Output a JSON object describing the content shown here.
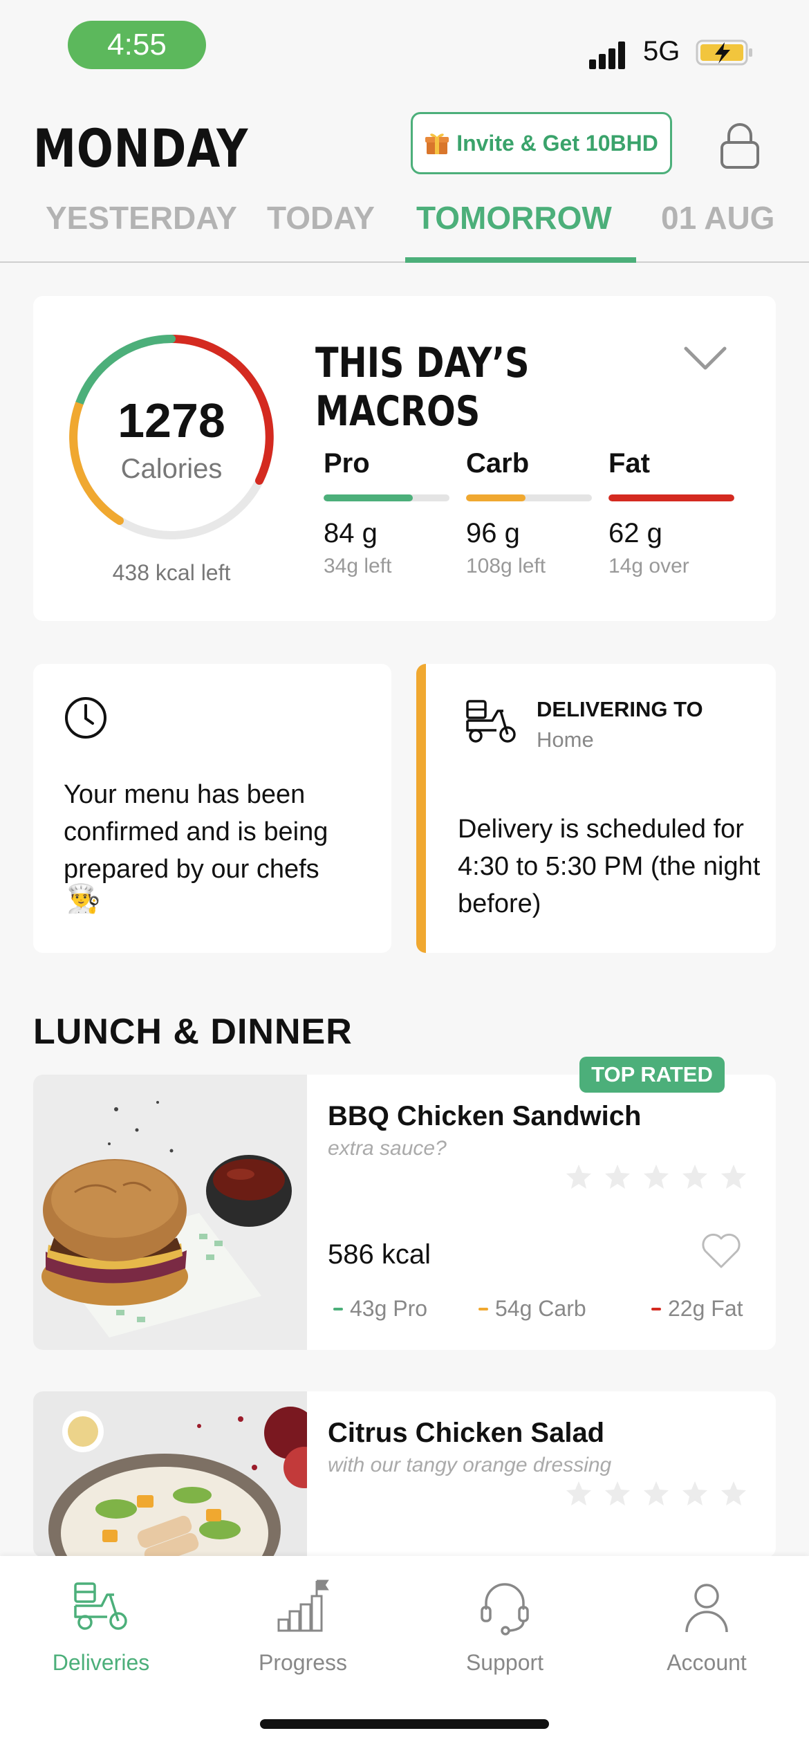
{
  "status": {
    "time": "4:55",
    "network": "5G"
  },
  "header": {
    "day": "MONDAY",
    "invite_label": "Invite & Get 10BHD",
    "tabs": [
      {
        "label": "YESTERDAY"
      },
      {
        "label": "TODAY"
      },
      {
        "label": "TOMORROW"
      },
      {
        "label": "01 AUG"
      }
    ],
    "active_tab": "TOMORROW"
  },
  "macros": {
    "title": "THIS DAY’S MACROS",
    "calories": "1278",
    "calories_label": "Calories",
    "kcal_left": "438 kcal left",
    "items": [
      {
        "name": "Pro",
        "value": "84 g",
        "remaining": "34g left",
        "color": "#4caf7a",
        "progress": 0.71
      },
      {
        "name": "Carb",
        "value": "96 g",
        "remaining": "108g left",
        "color": "#f0a830",
        "progress": 0.47
      },
      {
        "name": "Fat",
        "value": "62 g",
        "remaining": "14g over",
        "color": "#d42a20",
        "progress": 1.0
      }
    ]
  },
  "confirmation": {
    "text": "Your menu has been confirmed and is being prepared by our chefs",
    "emoji": "👨‍🍳"
  },
  "delivery": {
    "label": "DELIVERING TO",
    "place": "Home",
    "text": "Delivery is scheduled for 4:30 to 5:30 PM (the night before)"
  },
  "section": {
    "title": "LUNCH & DINNER"
  },
  "meals": [
    {
      "badge": "TOP RATED",
      "name": "BBQ Chicken Sandwich",
      "subtitle": "extra sauce?",
      "rating": 0,
      "kcal": "586 kcal",
      "pro": "43g Pro",
      "carb": "54g Carb",
      "fat": "22g Fat"
    },
    {
      "name": "Citrus Chicken Salad",
      "subtitle": "with our tangy orange dressing",
      "rating": 0
    }
  ],
  "tabbar": {
    "items": [
      {
        "label": "Deliveries",
        "icon": "scooter-icon"
      },
      {
        "label": "Progress",
        "icon": "progress-chart-icon"
      },
      {
        "label": "Support",
        "icon": "headset-icon"
      },
      {
        "label": "Account",
        "icon": "person-icon"
      }
    ],
    "active": "Deliveries"
  },
  "colors": {
    "accent": "#4caf7a",
    "carb": "#f0a830",
    "fat": "#d42a20"
  }
}
